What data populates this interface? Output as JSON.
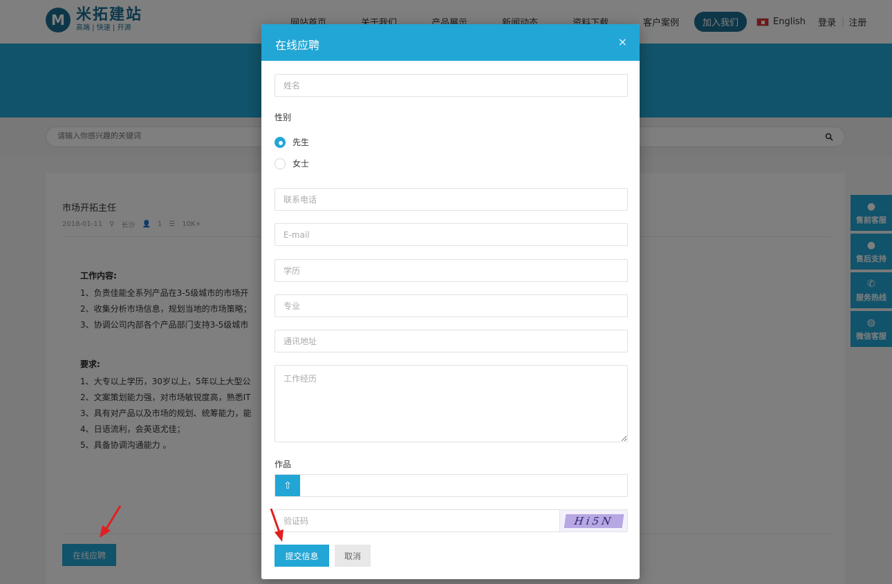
{
  "header": {
    "logo_mark": "M",
    "logo_name": "米拓建站",
    "logo_tagline": "高端 | 快速 | 开源",
    "nav": [
      "网站首页",
      "关于我们",
      "产品展示",
      "新闻动态",
      "资料下载"
    ],
    "nav_case": "客户案例",
    "join_label": "加入我们",
    "language": "English",
    "login": "登录",
    "register": "注册"
  },
  "search": {
    "placeholder": "请输入你感兴趣的关键词"
  },
  "job": {
    "title": "市场开拓主任",
    "date": "2018-01-11",
    "city": "长沙",
    "count": "1",
    "salary": "10K+",
    "content_heading": "工作内容:",
    "content_items": [
      "1、负责佳能全系列产品在3-5级城市的市场开",
      "2、收集分析市场信息，规划当地的市场策略；",
      "3、协调公司内部各个产品部门支持3-5级城市"
    ],
    "req_heading": "要求:",
    "req_items": [
      "1、大专以上学历，30岁以上，5年以上大型公",
      "2、文案策划能力强，对市场敏锐度高，熟悉IT",
      "3、具有对产品以及市场的规划、统筹能力，能",
      "4、日语流利，会英语尤佳；",
      "5、具备协调沟通能力 。"
    ],
    "apply_label": "在线应聘"
  },
  "float_service": [
    {
      "icon": "qq-icon",
      "label": "售前客服"
    },
    {
      "icon": "qq-icon",
      "label": "售后支持"
    },
    {
      "icon": "phone-icon",
      "label": "服务热线"
    },
    {
      "icon": "wechat-icon",
      "label": "微信客服"
    }
  ],
  "modal": {
    "title": "在线应聘",
    "close": "×",
    "name_placeholder": "姓名",
    "gender_label": "性别",
    "gender_options": [
      "先生",
      "女士"
    ],
    "gender_selected": "先生",
    "phone_placeholder": "联系电话",
    "email_placeholder": "E-mail",
    "education_placeholder": "学历",
    "major_placeholder": "专业",
    "address_placeholder": "通讯地址",
    "experience_placeholder": "工作经历",
    "works_label": "作品",
    "captcha_placeholder": "验证码",
    "captcha_text": "Hi5N",
    "submit_label": "提交信息",
    "cancel_label": "取消"
  },
  "colors": {
    "primary": "#22a6d5",
    "brand": "#1b6f92",
    "arrow": "#e02020"
  }
}
